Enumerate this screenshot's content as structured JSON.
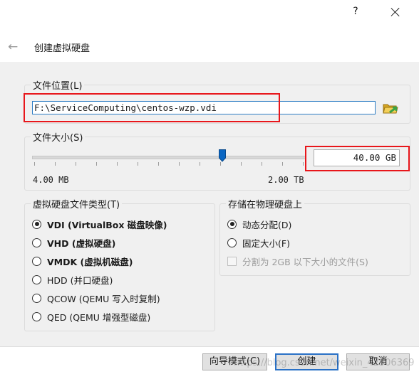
{
  "titlebar": {
    "help_label": "?",
    "close_icon": "close-icon"
  },
  "header": {
    "title": "创建虚拟硬盘",
    "back_icon": "back-arrow-icon"
  },
  "file_location": {
    "legend": "文件位置(L)",
    "path_value": "F:\\ServiceComputing\\centos-wzp.vdi",
    "folder_icon": "folder-icon"
  },
  "file_size": {
    "legend": "文件大小(S)",
    "min_label": "4.00 MB",
    "max_label": "2.00 TB",
    "value": "40.00 GB",
    "slider_fraction": 0.69
  },
  "disk_type": {
    "legend": "虚拟硬盘文件类型(T)",
    "options": [
      {
        "label": "VDI (VirtualBox 磁盘映像)",
        "selected": true
      },
      {
        "label": "VHD (虚拟硬盘)",
        "selected": false
      },
      {
        "label": "VMDK (虚拟机磁盘)",
        "selected": false
      },
      {
        "label": "HDD (并口硬盘)",
        "selected": false
      },
      {
        "label": "QCOW (QEMU 写入时复制)",
        "selected": false
      },
      {
        "label": "QED (QEMU 增强型磁盘)",
        "selected": false
      }
    ]
  },
  "storage": {
    "legend": "存储在物理硬盘上",
    "options": [
      {
        "label": "动态分配(D)",
        "selected": true
      },
      {
        "label": "固定大小(F)",
        "selected": false
      }
    ],
    "split_label": "分割为 2GB 以下大小的文件(S)",
    "split_enabled": false
  },
  "buttons": {
    "wizard_mode": "向导模式(C)",
    "create": "创建",
    "cancel": "取消"
  },
  "watermark": "https://blog.csdn.net/weixin_42506369",
  "colors": {
    "highlight": "#e8161b",
    "focus_border": "#2c7cc4"
  }
}
